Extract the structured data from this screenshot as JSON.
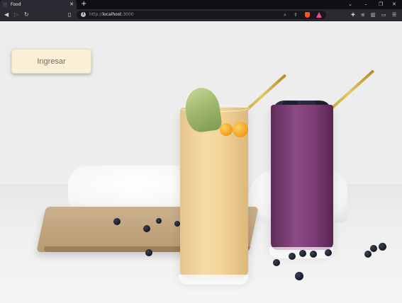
{
  "browser": {
    "tab": {
      "title": "Food"
    },
    "address_bar": {
      "protocol": "http://",
      "host": "localhost",
      "port": ":3000"
    }
  },
  "page": {
    "login_button": {
      "label": "Ingresar"
    }
  },
  "colors": {
    "button_background": "#faf0d7",
    "button_text": "#7a6a58",
    "chrome_dark": "#2a2a33",
    "brave_icon": "#fb542b"
  },
  "icons": {
    "tab_favicon": "page-icon",
    "tab_close": "close-icon",
    "new_tab": "plus-icon",
    "back": "arrow-left-icon",
    "forward": "arrow-right-icon",
    "reload": "reload-icon",
    "bookmark": "bookmark-icon",
    "site_info": "info-icon",
    "zoom": "search-icon",
    "share": "share-icon",
    "brave_shields": "brave-shield-icon",
    "brave_rewards": "brave-rewards-icon",
    "extensions": "puzzle-icon",
    "playlist": "playlist-icon",
    "sidebar": "sidebar-icon",
    "wallet": "wallet-icon",
    "menu": "hamburger-menu-icon",
    "minimize": "minimize-icon",
    "maximize": "maximize-icon",
    "window_close": "window-close-icon",
    "tab_search": "chevron-down-icon"
  }
}
